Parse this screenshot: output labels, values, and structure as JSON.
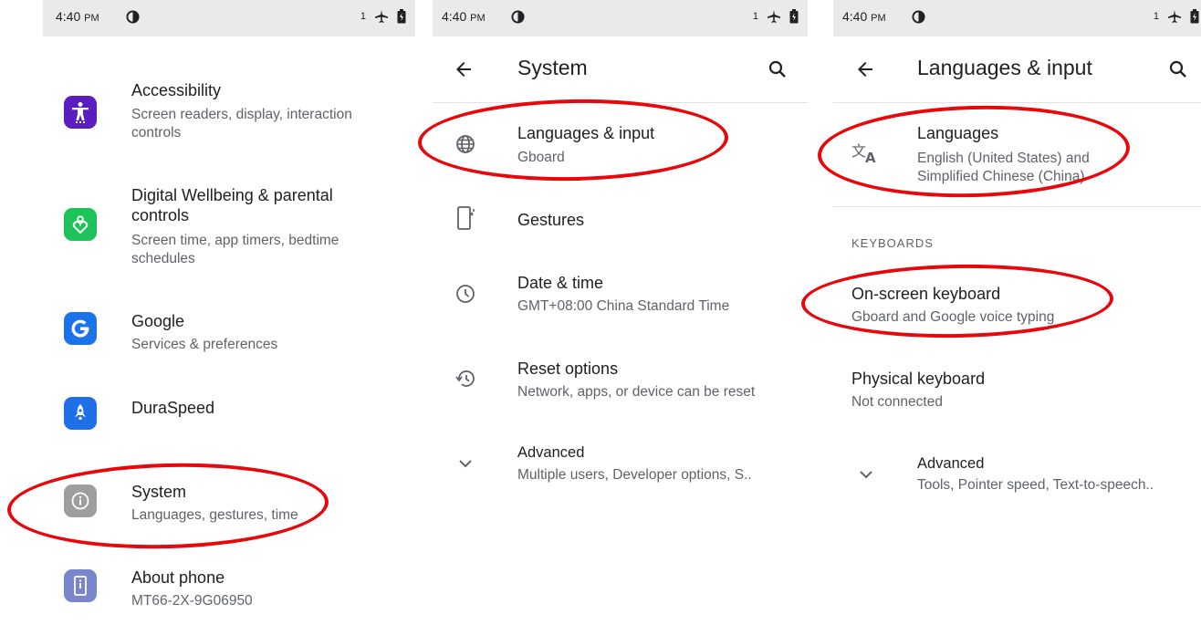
{
  "status_bar": {
    "time": "4:40",
    "ampm": "PM",
    "sim_badge": "1"
  },
  "panel1": {
    "items": [
      {
        "title": "Accessibility",
        "subtitle": "Screen readers, display, interaction controls"
      },
      {
        "title": "Digital Wellbeing & parental controls",
        "subtitle": "Screen time, app timers, bedtime schedules"
      },
      {
        "title": "Google",
        "subtitle": "Services & preferences"
      },
      {
        "title": "DuraSpeed",
        "subtitle": ""
      },
      {
        "title": "System",
        "subtitle": "Languages, gestures, time"
      },
      {
        "title": "About phone",
        "subtitle": "MT66-2X-9G06950"
      }
    ],
    "icon_colors": {
      "accessibility": "#5b1dbf",
      "wellbeing": "#1ec15a",
      "google": "#1a73e8",
      "duraspeed": "#1f6fe6",
      "system": "#9e9e9e",
      "about": "#7986cb"
    }
  },
  "panel2": {
    "title": "System",
    "items": [
      {
        "title": "Languages & input",
        "subtitle": "Gboard"
      },
      {
        "title": "Gestures",
        "subtitle": ""
      },
      {
        "title": "Date & time",
        "subtitle": "GMT+08:00 China Standard Time"
      },
      {
        "title": "Reset options",
        "subtitle": "Network, apps, or device can be reset"
      },
      {
        "title": "Advanced",
        "subtitle": "Multiple users, Developer options, S.."
      }
    ]
  },
  "panel3": {
    "title": "Languages & input",
    "languages": {
      "title": "Languages",
      "subtitle_line1": "English (United States) and",
      "subtitle_line2": "Simplified Chinese (China)"
    },
    "keyboards_header": "KEYBOARDS",
    "onscreen": {
      "title": "On-screen keyboard",
      "subtitle": "Gboard and Google voice typing"
    },
    "physical": {
      "title": "Physical keyboard",
      "subtitle": "Not connected"
    },
    "advanced": {
      "title": "Advanced",
      "subtitle": "Tools, Pointer speed, Text-to-speech.."
    }
  },
  "highlight_color": "#e8070b"
}
